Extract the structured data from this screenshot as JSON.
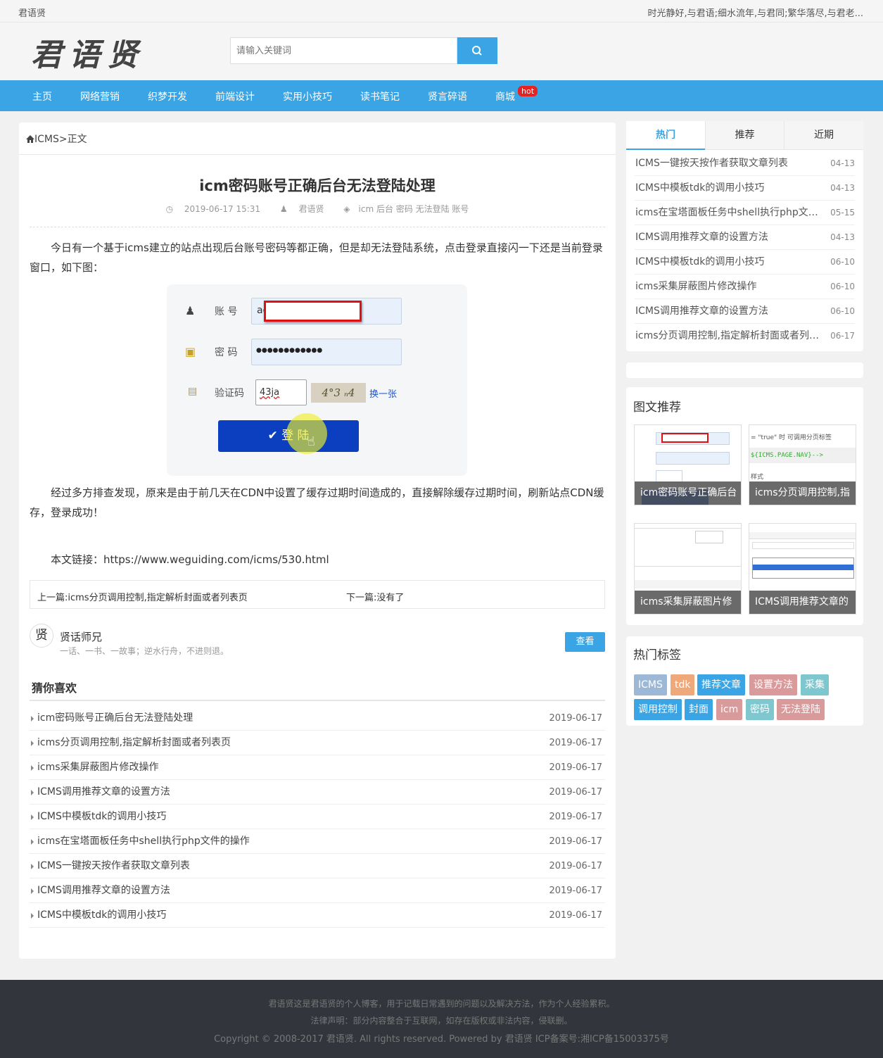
{
  "topbar": {
    "site_name": "君语贤",
    "motto": "时光静好,与君语;细水流年,与君同;繁华落尽,与君老..."
  },
  "header": {
    "logo_text": "君语贤",
    "search_placeholder": "请输入关键词"
  },
  "nav": {
    "items": [
      "主页",
      "网络营销",
      "织梦开发",
      "前端设计",
      "实用小技巧",
      "读书笔记",
      "贤言碎语",
      "商城"
    ],
    "hot_badge": "hot"
  },
  "breadcrumb": {
    "section": "ICMS",
    "separator": ">",
    "current": "正文"
  },
  "article": {
    "title": "icm密码账号正确后台无法登陆处理",
    "date": "2019-06-17 15:31",
    "author": "君语贤",
    "tags_line": "icm 后台 密码 无法登陆 账号",
    "para1": "今日有一个基于icms建立的站点出现后台账号密码等都正确，但是却无法登陆系统，点击登录直接闪一下还是当前登录窗口，如下图：",
    "para2": "经过多方排查发现，原来是由于前几天在CDN中设置了缓存过期时间造成的，直接解除缓存过期时间，刷新站点CDN缓存，登录成功！",
    "link_line": "本文链接：https://www.weguiding.com/icms/530.html",
    "screenshot": {
      "account_label": "账 号",
      "account_value": "ad",
      "password_label": "密 码",
      "password_value": "●●●●●●●●●●●●",
      "captcha_label": "验证码",
      "captcha_value": "43ja",
      "captcha_image": "4°3 ₙ4",
      "refresh_text": "换一张",
      "login_text": "登 陆"
    }
  },
  "prevnext": {
    "prev": "上一篇:icms分页调用控制,指定解析封面或者列表页",
    "next": "下一篇:没有了"
  },
  "author_box": {
    "avatar_char": "贤",
    "name": "贤话师兄",
    "desc": "一话、一书、一故事；逆水行舟，不进则退。",
    "button": "查看"
  },
  "guess": {
    "title": "猜你喜欢",
    "items": [
      {
        "title": "icm密码账号正确后台无法登陆处理",
        "date": "2019-06-17"
      },
      {
        "title": "icms分页调用控制,指定解析封面或者列表页",
        "date": "2019-06-17"
      },
      {
        "title": "icms采集屏蔽图片修改操作",
        "date": "2019-06-17"
      },
      {
        "title": "ICMS调用推荐文章的设置方法",
        "date": "2019-06-17"
      },
      {
        "title": "ICMS中模板tdk的调用小技巧",
        "date": "2019-06-17"
      },
      {
        "title": "icms在宝塔面板任务中shell执行php文件的操作",
        "date": "2019-06-17"
      },
      {
        "title": "ICMS一键按天按作者获取文章列表",
        "date": "2019-06-17"
      },
      {
        "title": "ICMS调用推荐文章的设置方法",
        "date": "2019-06-17"
      },
      {
        "title": "ICMS中模板tdk的调用小技巧",
        "date": "2019-06-17"
      }
    ]
  },
  "sidebar": {
    "tabs": [
      "热门",
      "推荐",
      "近期"
    ],
    "hot_list": [
      {
        "title": "ICMS一键按天按作者获取文章列表",
        "date": "04-13"
      },
      {
        "title": "ICMS中模板tdk的调用小技巧",
        "date": "04-13"
      },
      {
        "title": "icms在宝塔面板任务中shell执行php文件的操作",
        "date": "05-15"
      },
      {
        "title": "ICMS调用推荐文章的设置方法",
        "date": "04-13"
      },
      {
        "title": "ICMS中模板tdk的调用小技巧",
        "date": "06-10"
      },
      {
        "title": "icms采集屏蔽图片修改操作",
        "date": "06-10"
      },
      {
        "title": "ICMS调用推荐文章的设置方法",
        "date": "06-10"
      },
      {
        "title": "icms分页调用控制,指定解析封面或者列表页",
        "date": "06-17"
      }
    ],
    "pic_title": "图文推荐",
    "pics": [
      {
        "caption": "icm密码账号正确后台"
      },
      {
        "caption": "icms分页调用控制,指"
      },
      {
        "caption": "icms采集屏蔽图片修"
      },
      {
        "caption": "ICMS调用推荐文章的"
      }
    ],
    "pic2_code": "= \"true\" 时 可调用分页标签",
    "pic2_code2": "${ICMS.PAGE.NAV}-->",
    "pic2_code3": "样式",
    "tags_title": "热门标签",
    "tags": [
      {
        "label": "ICMS",
        "color": "#9db8d6"
      },
      {
        "label": "tdk",
        "color": "#efa87a"
      },
      {
        "label": "推荐文章",
        "color": "#3aa4e4"
      },
      {
        "label": "设置方法",
        "color": "#d89a9a"
      },
      {
        "label": "采集",
        "color": "#7fc7cf"
      },
      {
        "label": "调用控制",
        "color": "#3aa4e4"
      },
      {
        "label": "封面",
        "color": "#3aa4e4"
      },
      {
        "label": "icm",
        "color": "#d89a9a"
      },
      {
        "label": "密码",
        "color": "#7fc7cf"
      },
      {
        "label": "无法登陆",
        "color": "#d89a9a"
      }
    ]
  },
  "footer": {
    "line1": "君语贤这是君语贤的个人博客，用于记载日常遇到的问题以及解决方法，作为个人经验累积。",
    "line2": "法律声明：部分内容整合于互联网，如存在版权或非法内容，侵联删。",
    "line3": "Copyright © 2008-2017 君语贤. All rights reserved. Powered by 君语贤 ICP备案号:湘ICP备15003375号"
  }
}
